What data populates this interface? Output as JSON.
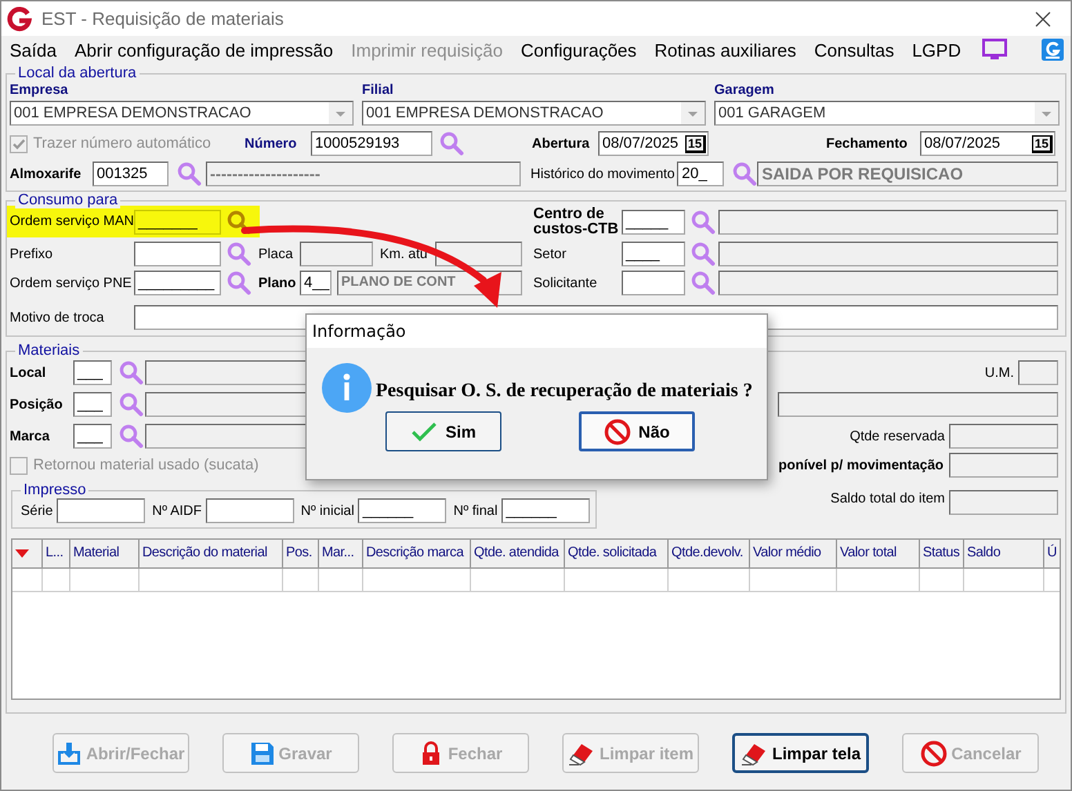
{
  "window": {
    "title": "EST - Requisição de materiais"
  },
  "menu": [
    {
      "label": "Saída",
      "disabled": false
    },
    {
      "label": "Abrir configuração de impressão",
      "disabled": false
    },
    {
      "label": "Imprimir requisição",
      "disabled": true
    },
    {
      "label": "Configurações",
      "disabled": false
    },
    {
      "label": "Rotinas auxiliares",
      "disabled": false
    },
    {
      "label": "Consultas",
      "disabled": false
    },
    {
      "label": "LGPD",
      "disabled": false
    }
  ],
  "local_abertura": {
    "title": "Local da abertura",
    "empresa": {
      "label": "Empresa",
      "value": "001 EMPRESA DEMONSTRACAO"
    },
    "filial": {
      "label": "Filial",
      "value": "001 EMPRESA DEMONSTRACAO"
    },
    "garagem": {
      "label": "Garagem",
      "value": "001 GARAGEM"
    },
    "trazer_numero": {
      "label": "Trazer número automático",
      "checked": true,
      "disabled": true
    },
    "numero": {
      "label": "Número",
      "value": "1000529193"
    },
    "abertura": {
      "label": "Abertura",
      "value": "08/07/2025",
      "calendar": "15"
    },
    "fechamento": {
      "label": "Fechamento",
      "value": "08/07/2025",
      "calendar": "15"
    },
    "almoxarife": {
      "label": "Almoxarife",
      "value": "001325",
      "description": "--------------------"
    },
    "historico": {
      "label": "Histórico do movimento",
      "value": "20_",
      "description": "SAIDA POR REQUISICAO"
    }
  },
  "consumo": {
    "title": "Consumo para",
    "ordem_man": {
      "label": "Ordem serviço MAN",
      "value": "_______",
      "highlighted": true
    },
    "prefixo": {
      "label": "Prefixo"
    },
    "placa": {
      "label": "Placa"
    },
    "km": {
      "label": "Km. atu"
    },
    "ordem_pne": {
      "label": "Ordem serviço PNE",
      "value": "_________"
    },
    "plano": {
      "label": "Plano",
      "value": "4__",
      "description": "PLANO DE CONT"
    },
    "motivo": {
      "label": "Motivo de troca"
    },
    "centro": {
      "label": "Centro de custos-CTB",
      "value": "_____"
    },
    "setor": {
      "label": "Setor",
      "value": "____"
    },
    "solicitante": {
      "label": "Solicitante"
    }
  },
  "materiais": {
    "title": "Materiais",
    "local": {
      "label": "Local",
      "value": "___"
    },
    "posicao": {
      "label": "Posição",
      "value": "___"
    },
    "marca": {
      "label": "Marca",
      "value": "___"
    },
    "um": {
      "label": "U.M."
    },
    "qtde_reservada": {
      "label": "Qtde reservada"
    },
    "retornou": {
      "label": "Retornou material usado (sucata)",
      "checked": false,
      "disabled": true
    },
    "disponivel": {
      "label": "ponível p/ movimentação"
    },
    "saldo_total": {
      "label": "Saldo total do item"
    },
    "impresso": {
      "title": "Impresso",
      "fields": [
        {
          "label": "Série"
        },
        {
          "label": "Nº AIDF"
        },
        {
          "label": "Nº inicial",
          "value": "______"
        },
        {
          "label": "Nº final",
          "value": "______"
        }
      ]
    },
    "table": {
      "columns": [
        "L...",
        "Material",
        "Descrição do material",
        "Pos.",
        "Mar...",
        "Descrição marca",
        "Qtde. atendida",
        "Qtde. solicitada",
        "Qtde.devolv.",
        "Valor médio",
        "Valor total",
        "Status",
        "Saldo",
        "Ú"
      ]
    }
  },
  "buttons": [
    {
      "label": "Abrir/Fechar",
      "kind": "download",
      "disabled": true,
      "default": false
    },
    {
      "label": "Gravar",
      "kind": "save",
      "disabled": true,
      "default": false
    },
    {
      "label": "Fechar",
      "kind": "lock",
      "disabled": true,
      "default": false
    },
    {
      "label": "Limpar item",
      "kind": "eraser",
      "disabled": true,
      "default": false
    },
    {
      "label": "Limpar tela",
      "kind": "eraser",
      "disabled": false,
      "default": true
    },
    {
      "label": "Cancelar",
      "kind": "cancel",
      "disabled": true,
      "default": false
    }
  ],
  "dialog": {
    "title": "Informação",
    "message": "Pesquisar O. S. de recuperação de materiais ?",
    "buttons": [
      {
        "label": "Sim",
        "kind": "check",
        "focused": false
      },
      {
        "label": "Não",
        "kind": "cancel",
        "focused": true
      }
    ]
  }
}
